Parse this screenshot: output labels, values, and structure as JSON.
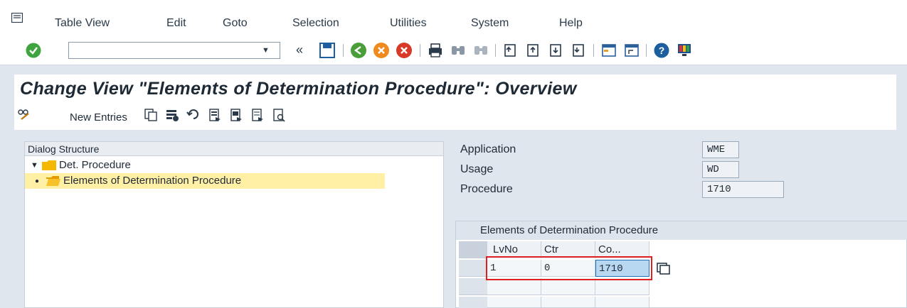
{
  "menu": {
    "items": [
      "Table View",
      "Edit",
      "Goto",
      "Selection",
      "Utilities",
      "System",
      "Help"
    ]
  },
  "toolbar": {
    "command_field_value": "",
    "icons": [
      "ok-icon",
      "save-icon",
      "back-icon",
      "exit-icon",
      "cancel-icon",
      "print-icon",
      "find-icon",
      "find-next-icon",
      "first-page-icon",
      "previous-page-icon",
      "next-page-icon",
      "last-page-icon",
      "create-session-icon",
      "shortcut-icon",
      "help-icon",
      "customize-layout-icon"
    ]
  },
  "title": "Change View \"Elements of Determination Procedure\": Overview",
  "app_toolbar": {
    "new_entries_label": "New Entries",
    "icons": [
      "display-change-icon",
      "copy-icon",
      "delete-icon",
      "undo-icon",
      "select-all-icon",
      "select-block-icon",
      "deselect-all-icon",
      "choose-icon"
    ]
  },
  "dialog_structure": {
    "header": "Dialog Structure",
    "items": [
      {
        "label": "Det. Procedure",
        "expanded": true,
        "selected": false
      },
      {
        "label": "Elements of Determination Procedure",
        "selected": true
      }
    ]
  },
  "fields": [
    {
      "label": "Application",
      "value": "WME"
    },
    {
      "label": "Usage",
      "value": "WD"
    },
    {
      "label": "Procedure",
      "value": "1710"
    }
  ],
  "table": {
    "title": "Elements of Determination Procedure",
    "columns": [
      "LvNo",
      "Ctr",
      "Co..."
    ],
    "rows": [
      [
        "1",
        "0",
        "1710"
      ]
    ]
  },
  "colors": {
    "accent_highlight": "#e02020",
    "selected_row": "#fff0a6",
    "folder": "#f5b800"
  }
}
